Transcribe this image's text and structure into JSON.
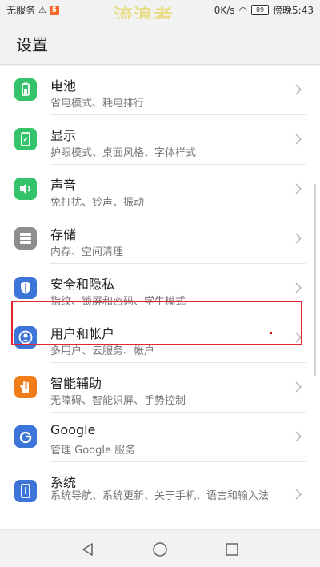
{
  "status_bar": {
    "carrier": "无服务",
    "warning_icon": "warning-icon",
    "badge": "5",
    "watermark": "流浪者",
    "speed": "0K/s",
    "battery": "89",
    "time": "傍晚5:43"
  },
  "header": {
    "title": "设置"
  },
  "items": [
    {
      "title": "电池",
      "subtitle": "省电模式、耗电排行",
      "icon": "battery-icon",
      "color": "#34c36b"
    },
    {
      "title": "显示",
      "subtitle": "护眼模式、桌面风格、字体样式",
      "icon": "display-icon",
      "color": "#34c36b"
    },
    {
      "title": "声音",
      "subtitle": "免打扰、铃声、振动",
      "icon": "sound-icon",
      "color": "#34c36b"
    },
    {
      "title": "存储",
      "subtitle": "内存、空间清理",
      "icon": "storage-icon",
      "color": "#8d8d8d"
    },
    {
      "title": "安全和隐私",
      "subtitle": "指纹、锁屏和密码、学生模式",
      "icon": "shield-icon",
      "color": "#3d74d8"
    },
    {
      "title": "用户和帐户",
      "subtitle": "多用户、云服务、帐户",
      "icon": "user-icon",
      "color": "#3d74d8"
    },
    {
      "title": "智能辅助",
      "subtitle": "无障碍、智能识屏、手势控制",
      "icon": "hand-icon",
      "color": "#f07d1a"
    },
    {
      "title": "Google",
      "subtitle": "管理 Google 服务",
      "icon": "google-icon",
      "color": "#3d74d8"
    },
    {
      "title": "系统",
      "subtitle": "系统导航、系统更新、关于手机、语言和输入法",
      "icon": "info-icon",
      "color": "#3d74d8"
    }
  ],
  "navbar": {
    "back": "back-icon",
    "home": "home-icon",
    "recents": "recents-icon"
  }
}
